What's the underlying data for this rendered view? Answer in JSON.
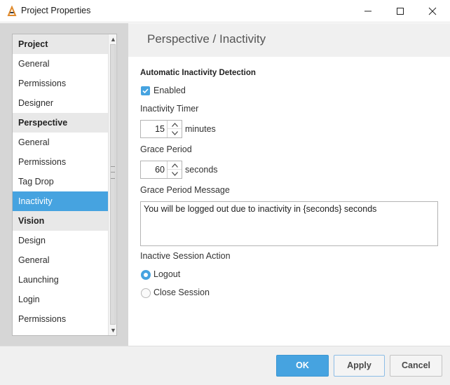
{
  "window": {
    "title": "Project Properties",
    "icon": "ignition-logo-icon"
  },
  "sidebar": {
    "items": [
      {
        "label": "Project",
        "type": "header"
      },
      {
        "label": "General",
        "type": "item"
      },
      {
        "label": "Permissions",
        "type": "item"
      },
      {
        "label": "Designer",
        "type": "item"
      },
      {
        "label": "Perspective",
        "type": "header"
      },
      {
        "label": "General",
        "type": "item"
      },
      {
        "label": "Permissions",
        "type": "item"
      },
      {
        "label": "Tag Drop",
        "type": "item"
      },
      {
        "label": "Inactivity",
        "type": "item",
        "selected": true
      },
      {
        "label": "Vision",
        "type": "header"
      },
      {
        "label": "Design",
        "type": "item"
      },
      {
        "label": "General",
        "type": "item"
      },
      {
        "label": "Launching",
        "type": "item"
      },
      {
        "label": "Login",
        "type": "item"
      },
      {
        "label": "Permissions",
        "type": "item"
      }
    ]
  },
  "main": {
    "title": "Perspective / Inactivity",
    "section_title": "Automatic Inactivity Detection",
    "enabled_label": "Enabled",
    "enabled_checked": true,
    "inactivity_timer_label": "Inactivity Timer",
    "inactivity_timer_value": "15",
    "inactivity_timer_unit": "minutes",
    "grace_period_label": "Grace Period",
    "grace_period_value": "60",
    "grace_period_unit": "seconds",
    "grace_message_label": "Grace Period Message",
    "grace_message_value": "You will be logged out due to inactivity in {seconds} seconds",
    "session_action_label": "Inactive Session Action",
    "session_action_options": [
      "Logout",
      "Close Session"
    ],
    "session_action_selected": "Logout"
  },
  "footer": {
    "ok_label": "OK",
    "apply_label": "Apply",
    "cancel_label": "Cancel"
  },
  "colors": {
    "accent": "#46a3e0",
    "panel": "#d6d6d6",
    "header_band": "#f0f0f0"
  }
}
